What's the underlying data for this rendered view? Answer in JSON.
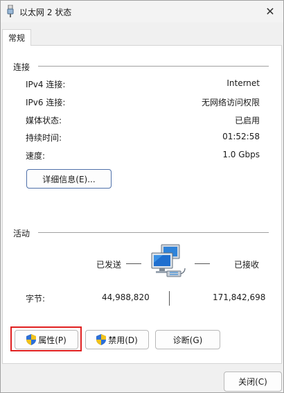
{
  "window": {
    "title": "以太网 2 状态",
    "close_glyph": "✕"
  },
  "tabs": [
    {
      "label": "常规"
    }
  ],
  "connection": {
    "group_title": "连接",
    "rows": [
      {
        "label": "IPv4 连接:",
        "value": "Internet"
      },
      {
        "label": "IPv6 连接:",
        "value": "无网络访问权限"
      },
      {
        "label": "媒体状态:",
        "value": "已启用"
      },
      {
        "label": "持续时间:",
        "value": "01:52:58"
      },
      {
        "label": "速度:",
        "value": "1.0 Gbps"
      }
    ],
    "details_button": "详细信息(E)..."
  },
  "activity": {
    "group_title": "活动",
    "sent_label": "已发送",
    "received_label": "已接收",
    "bytes_label": "字节:",
    "bytes_sent": "44,988,820",
    "bytes_received": "171,842,698"
  },
  "actions": {
    "properties": "属性(P)",
    "disable": "禁用(D)",
    "diagnose": "诊断(G)"
  },
  "footer": {
    "close_button": "关闭(C)"
  },
  "icons": {
    "title": "network-adapter-icon",
    "shield": "uac-shield-icon",
    "activity": "network-computers-icon"
  },
  "colors": {
    "highlight": "#e02020",
    "shield_blue": "#2d6fd6",
    "shield_yellow": "#f2c21b"
  }
}
